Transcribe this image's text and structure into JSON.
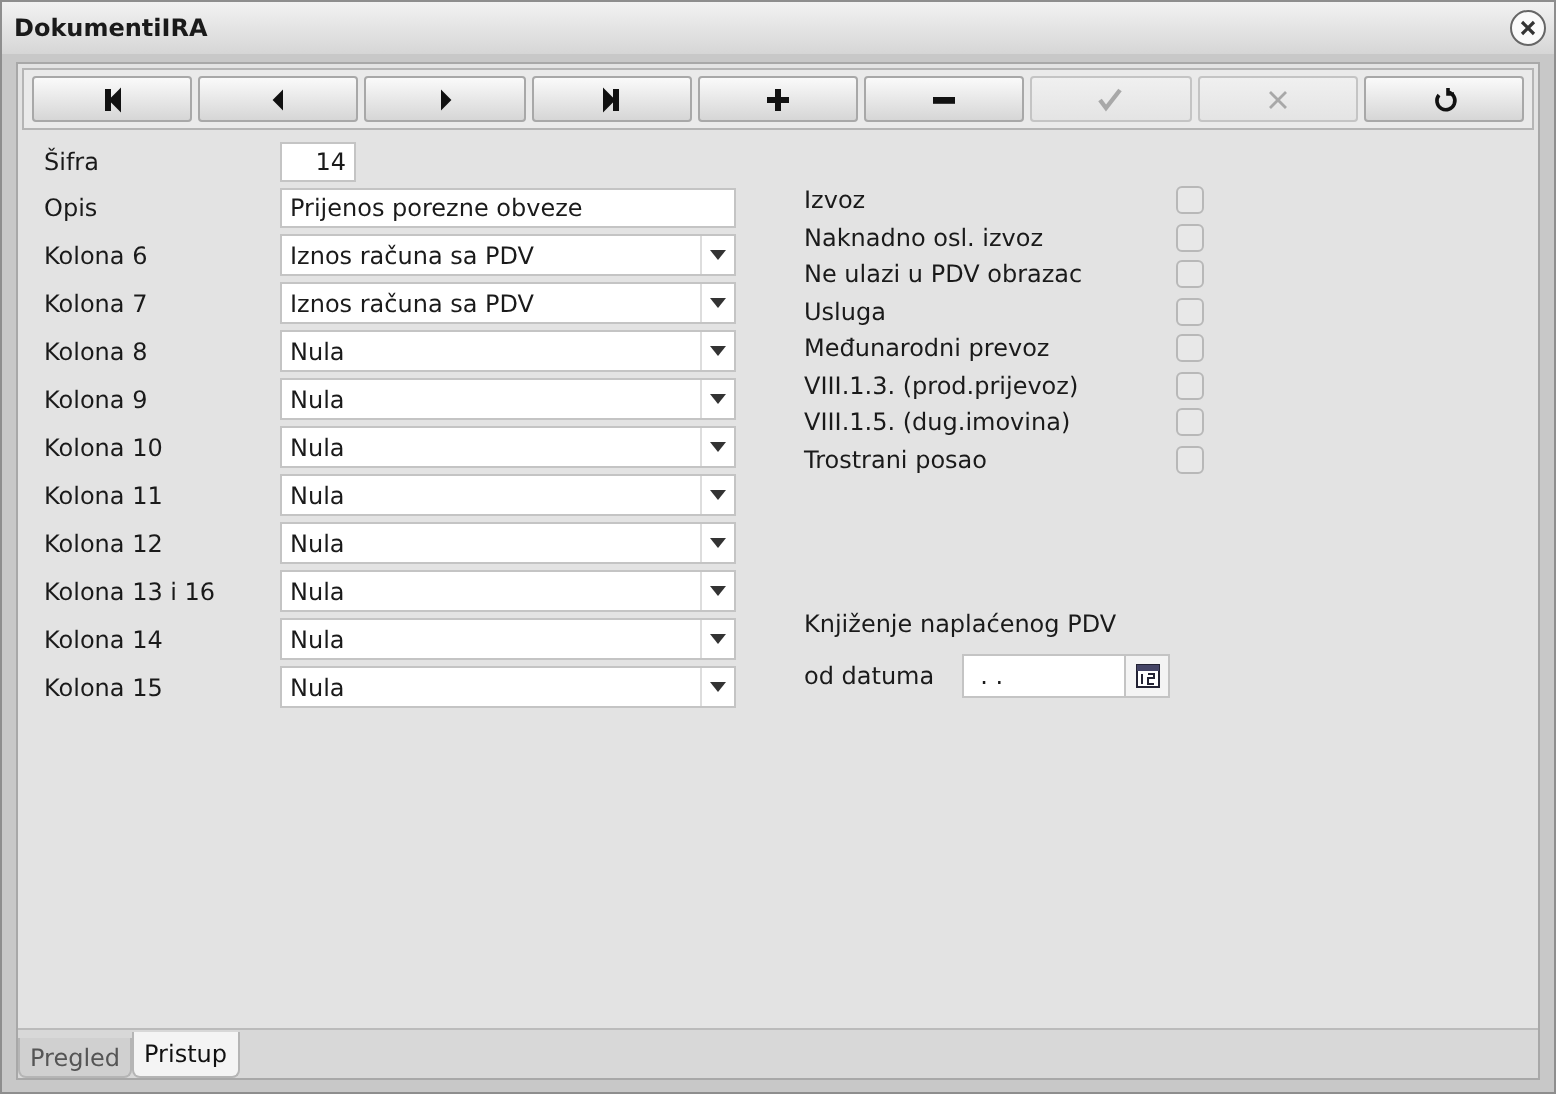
{
  "window": {
    "title": "DokumentiIRA"
  },
  "toolbar": [
    {
      "kind": "first",
      "disabled": false
    },
    {
      "kind": "prev",
      "disabled": false
    },
    {
      "kind": "next",
      "disabled": false
    },
    {
      "kind": "last",
      "disabled": false
    },
    {
      "kind": "add",
      "disabled": false
    },
    {
      "kind": "remove",
      "disabled": false
    },
    {
      "kind": "confirm",
      "disabled": true
    },
    {
      "kind": "cancel",
      "disabled": true
    },
    {
      "kind": "refresh",
      "disabled": false
    }
  ],
  "fields": [
    {
      "kind": "short",
      "label": "Šifra",
      "value": "14"
    },
    {
      "kind": "text",
      "label": "Opis",
      "value": "Prijenos porezne obveze"
    },
    {
      "kind": "select",
      "label": "Kolona 6",
      "value": "Iznos računa sa PDV"
    },
    {
      "kind": "select",
      "label": "Kolona 7",
      "value": "Iznos računa sa PDV"
    },
    {
      "kind": "select",
      "label": "Kolona 8",
      "value": "Nula"
    },
    {
      "kind": "select",
      "label": "Kolona 9",
      "value": "Nula"
    },
    {
      "kind": "select",
      "label": "Kolona 10",
      "value": "Nula"
    },
    {
      "kind": "select",
      "label": "Kolona 11",
      "value": "Nula"
    },
    {
      "kind": "select",
      "label": "Kolona 12",
      "value": "Nula"
    },
    {
      "kind": "select",
      "label": "Kolona 13 i 16",
      "value": "Nula"
    },
    {
      "kind": "select",
      "label": "Kolona 14",
      "value": "Nula"
    },
    {
      "kind": "select",
      "label": "Kolona 15",
      "value": "Nula"
    }
  ],
  "checkboxes": [
    {
      "label": "Izvoz",
      "checked": false
    },
    {
      "label": "Naknadno osl. izvoz",
      "checked": false
    },
    {
      "label": "Ne ulazi u PDV obrazac",
      "checked": false
    },
    {
      "label": "Usluga",
      "checked": false
    },
    {
      "label": "Međunarodni prevoz",
      "checked": false
    },
    {
      "label": "VIII.1.3. (prod.prijevoz)",
      "checked": false
    },
    {
      "label": "VIII.1.5. (dug.imovina)",
      "checked": false
    },
    {
      "label": "Trostrani posao",
      "checked": false
    }
  ],
  "posting": {
    "heading": "Knjiženje naplaćenog PDV",
    "date_label": "od datuma",
    "date_value": ". ."
  },
  "tabs": [
    {
      "label": "Pregled",
      "selected": false
    },
    {
      "label": "Pristup",
      "selected": true
    }
  ]
}
